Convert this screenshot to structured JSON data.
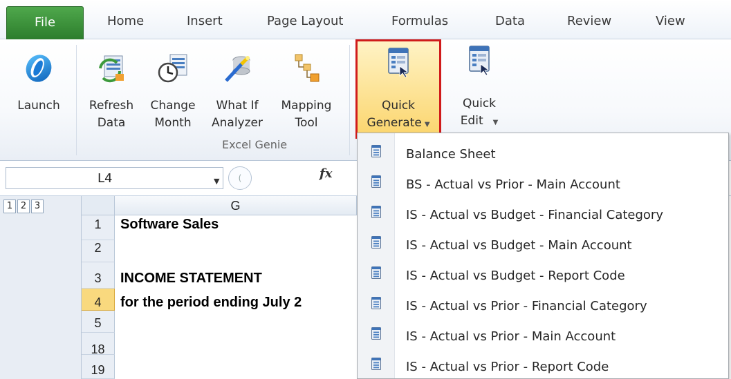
{
  "tabs": {
    "file": "File",
    "home": "Home",
    "insert": "Insert",
    "page_layout": "Page Layout",
    "formulas": "Formulas",
    "data": "Data",
    "review": "Review",
    "view": "View"
  },
  "ribbon": {
    "launch": "Launch",
    "refresh_l1": "Refresh",
    "refresh_l2": "Data",
    "change_l1": "Change",
    "change_l2": "Month",
    "whatif_l1": "What If",
    "whatif_l2": "Analyzer",
    "mapping_l1": "Mapping",
    "mapping_l2": "Tool",
    "quick_gen_l1": "Quick",
    "quick_gen_l2": "Generate",
    "quick_edit_l1": "Quick",
    "quick_edit_l2": "Edit",
    "group_label": "Excel Genie",
    "icons": {
      "launch": "launch-swirl-icon",
      "refresh": "refresh-data-icon",
      "change": "change-month-clock-icon",
      "whatif": "what-if-analyzer-icon",
      "mapping": "mapping-tool-icon",
      "quick_gen": "quick-generate-icon",
      "quick_edit": "quick-edit-icon"
    }
  },
  "formula_bar": {
    "name_box": "L4",
    "fx": "fx"
  },
  "sheet": {
    "outline_levels": [
      "1",
      "2",
      "3"
    ],
    "column": "G",
    "active_row": "4",
    "rows": [
      {
        "num": "1",
        "text": "Software Sales"
      },
      {
        "num": "2",
        "text": ""
      },
      {
        "num": "3",
        "text": "INCOME STATEMENT"
      },
      {
        "num": "4",
        "text": "for the period ending July 2"
      },
      {
        "num": "5",
        "text": ""
      },
      {
        "num": "18",
        "text": ""
      },
      {
        "num": "19",
        "text": ""
      }
    ]
  },
  "menu": {
    "items": [
      "Balance Sheet",
      "BS - Actual vs Prior - Main Account",
      "IS - Actual vs Budget - Financial Category",
      "IS - Actual vs Budget - Main Account",
      "IS - Actual vs Budget - Report Code",
      "IS - Actual vs Prior - Financial Category",
      "IS - Actual vs Prior - Main Account",
      "IS - Actual vs Prior - Report Code"
    ],
    "item_icon": "report-document-icon"
  },
  "colors": {
    "file_tab": "#2f8a2f",
    "highlight_border": "#d01b1b",
    "active_row": "#f9d97e"
  }
}
